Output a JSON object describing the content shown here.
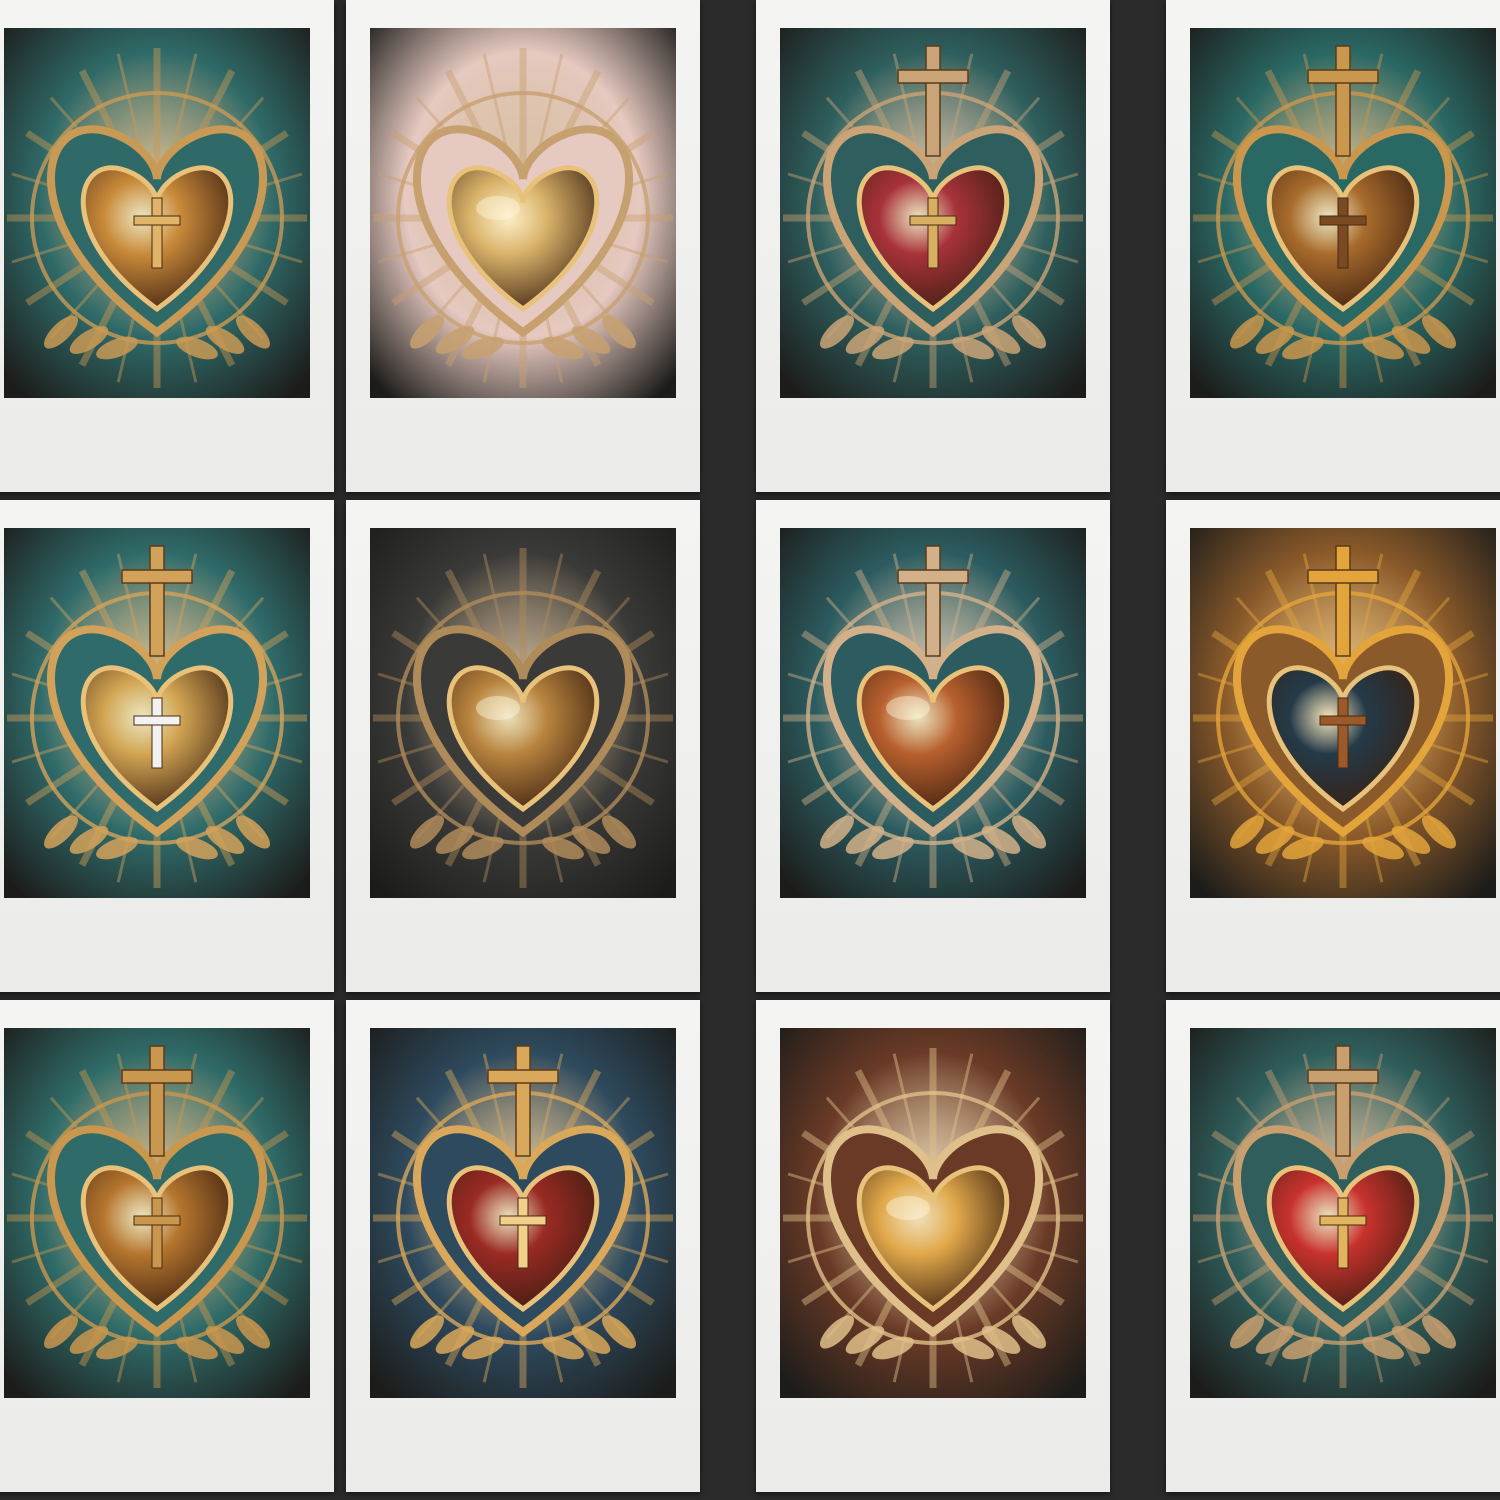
{
  "gallery": {
    "columns": 4,
    "rows": 3,
    "background_color": "#2b2b2b",
    "frame_color": "#f2f2f0",
    "cards": [
      {
        "motif": "heart-cross-icon",
        "bg": "#2f6a68",
        "ornament": "#c99a55",
        "heart": "#c98a3a",
        "cross": "#e0b56a",
        "has_top_cross": false
      },
      {
        "motif": "heart-icon",
        "bg": "#e6c9c0",
        "ornament": "#c7a070",
        "heart": "#d9b36a",
        "cross": "#d9b36a",
        "has_top_cross": false
      },
      {
        "motif": "heart-cross-icon",
        "bg": "#2e5f5e",
        "ornament": "#caa477",
        "heart": "#a8323a",
        "cross": "#d8ae62",
        "has_top_cross": true
      },
      {
        "motif": "heart-cross-icon",
        "bg": "#2a6864",
        "ornament": "#c9974e",
        "heart": "#a86b2c",
        "cross": "#7a4a22",
        "has_top_cross": true
      },
      {
        "motif": "heart-cross-icon",
        "bg": "#2f6b6a",
        "ornament": "#d3a25a",
        "heart": "#d2a553",
        "cross": "#f2f2f2",
        "has_top_cross": true
      },
      {
        "motif": "heart-icon",
        "bg": "#3a3a38",
        "ornament": "#b08b5a",
        "heart": "#b8843e",
        "cross": "#b8843e",
        "has_top_cross": false
      },
      {
        "motif": "heart-icon",
        "bg": "#2c5c60",
        "ornament": "#d2b18a",
        "heart": "#b8602e",
        "cross": "#d2a553",
        "has_top_cross": true
      },
      {
        "motif": "heart-cross-icon",
        "bg": "#8a5a2a",
        "ornament": "#e3a43b",
        "heart": "#243a48",
        "cross": "#9a5a2a",
        "has_top_cross": true
      },
      {
        "motif": "heart-cross-icon",
        "bg": "#2f6b68",
        "ornament": "#c9974e",
        "heart": "#b5762e",
        "cross": "#c9974e",
        "has_top_cross": true
      },
      {
        "motif": "heart-cross-icon",
        "bg": "#2e4a5e",
        "ornament": "#d9a85a",
        "heart": "#9a2a24",
        "cross": "#f0d08a",
        "has_top_cross": true
      },
      {
        "motif": "heart-icon",
        "bg": "#6a3a26",
        "ornament": "#e0c08a",
        "heart": "#e0a84a",
        "cross": "#f5e3b8",
        "has_top_cross": false
      },
      {
        "motif": "heart-cross-icon",
        "bg": "#2f5e5c",
        "ornament": "#c8a070",
        "heart": "#c8322e",
        "cross": "#e2b460",
        "has_top_cross": true
      }
    ]
  }
}
